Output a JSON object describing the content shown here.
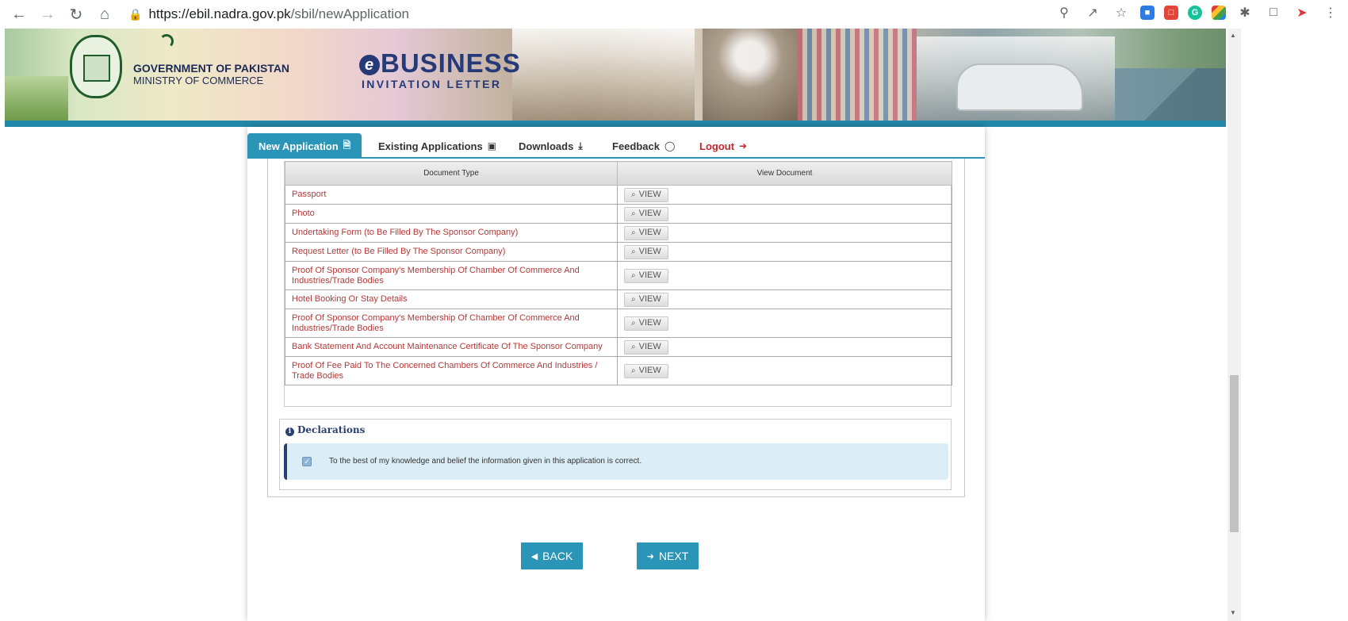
{
  "browser": {
    "url_host": "https://ebil.nadra.gov.pk",
    "url_path": "/sbil/newApplication"
  },
  "banner": {
    "gov_line1": "GOVERNMENT OF PAKISTAN",
    "gov_line2": "MINISTRY OF COMMERCE",
    "logo_main": "BUSINESS",
    "logo_sub": "INVITATION LETTER"
  },
  "tabs": [
    {
      "label": "New Application",
      "icon": "document-icon"
    },
    {
      "label": "Existing Applications",
      "icon": "briefcase-icon"
    },
    {
      "label": "Downloads",
      "icon": "download-icon"
    },
    {
      "label": "Feedback",
      "icon": "comment-icon"
    },
    {
      "label": "Logout",
      "icon": "logout-icon"
    }
  ],
  "documents": {
    "header_type": "Document Type",
    "header_view": "View Document",
    "view_label": "VIEW",
    "rows": [
      "Passport",
      "Photo",
      "Undertaking Form (to Be Filled By The Sponsor Company)",
      "Request Letter (to Be Filled By The Sponsor Company)",
      "Proof Of Sponsor Company's Membership Of Chamber Of Commerce And Industries/Trade Bodies",
      "Hotel Booking Or Stay Details",
      "Proof Of Sponsor Company's Membership Of Chamber Of Commerce And Industries/Trade Bodies",
      "Bank Statement And Account Maintenance Certificate Of The Sponsor Company",
      "Proof Of Fee Paid To The Concerned Chambers Of Commerce And Industries / Trade Bodies"
    ]
  },
  "declarations": {
    "title": "Declarations",
    "text": "To the best of my knowledge and belief the information given in this application is correct.",
    "checked": true
  },
  "buttons": {
    "back": "BACK",
    "next": "NEXT"
  },
  "colors": {
    "accent": "#2b95b8",
    "doc_text": "#b23a3a",
    "logout": "#c0282d"
  }
}
